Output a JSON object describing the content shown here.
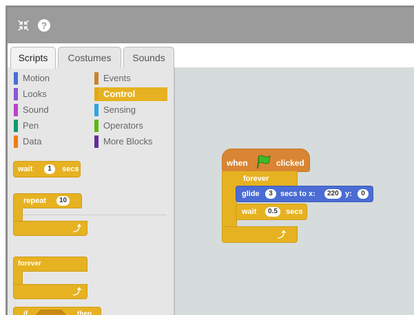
{
  "topbar": {
    "icons": [
      "shrink-icon",
      "help-icon"
    ]
  },
  "tabs": [
    {
      "label": "Scripts",
      "active": true
    },
    {
      "label": "Costumes",
      "active": false
    },
    {
      "label": "Sounds",
      "active": false
    }
  ],
  "categories": {
    "motion": {
      "label": "Motion",
      "color": "#4a6cd4"
    },
    "looks": {
      "label": "Looks",
      "color": "#8a55d7"
    },
    "sound": {
      "label": "Sound",
      "color": "#bb42c3"
    },
    "pen": {
      "label": "Pen",
      "color": "#0e9a6c"
    },
    "data": {
      "label": "Data",
      "color": "#ee7d16"
    },
    "events": {
      "label": "Events",
      "color": "#c88330"
    },
    "control": {
      "label": "Control",
      "color": "#e1a91a",
      "active": true
    },
    "sensing": {
      "label": "Sensing",
      "color": "#2ca5e2"
    },
    "operators": {
      "label": "Operators",
      "color": "#5cb712"
    },
    "more": {
      "label": "More Blocks",
      "color": "#632d99"
    }
  },
  "palette_blocks": {
    "wait": {
      "label": "wait",
      "value": "1",
      "unit": "secs"
    },
    "repeat": {
      "label": "repeat",
      "value": "10"
    },
    "forever": {
      "label": "forever"
    },
    "if": {
      "label": "if",
      "then": "then"
    }
  },
  "script": {
    "hat": {
      "when": "when",
      "clicked": "clicked"
    },
    "forever": {
      "label": "forever"
    },
    "glide": {
      "label": "glide",
      "secs": "3",
      "secs_label": "secs to x:",
      "x": "220",
      "y_label": "y:",
      "y": "0"
    },
    "wait": {
      "label": "wait",
      "value": "0.5",
      "unit": "secs"
    }
  }
}
